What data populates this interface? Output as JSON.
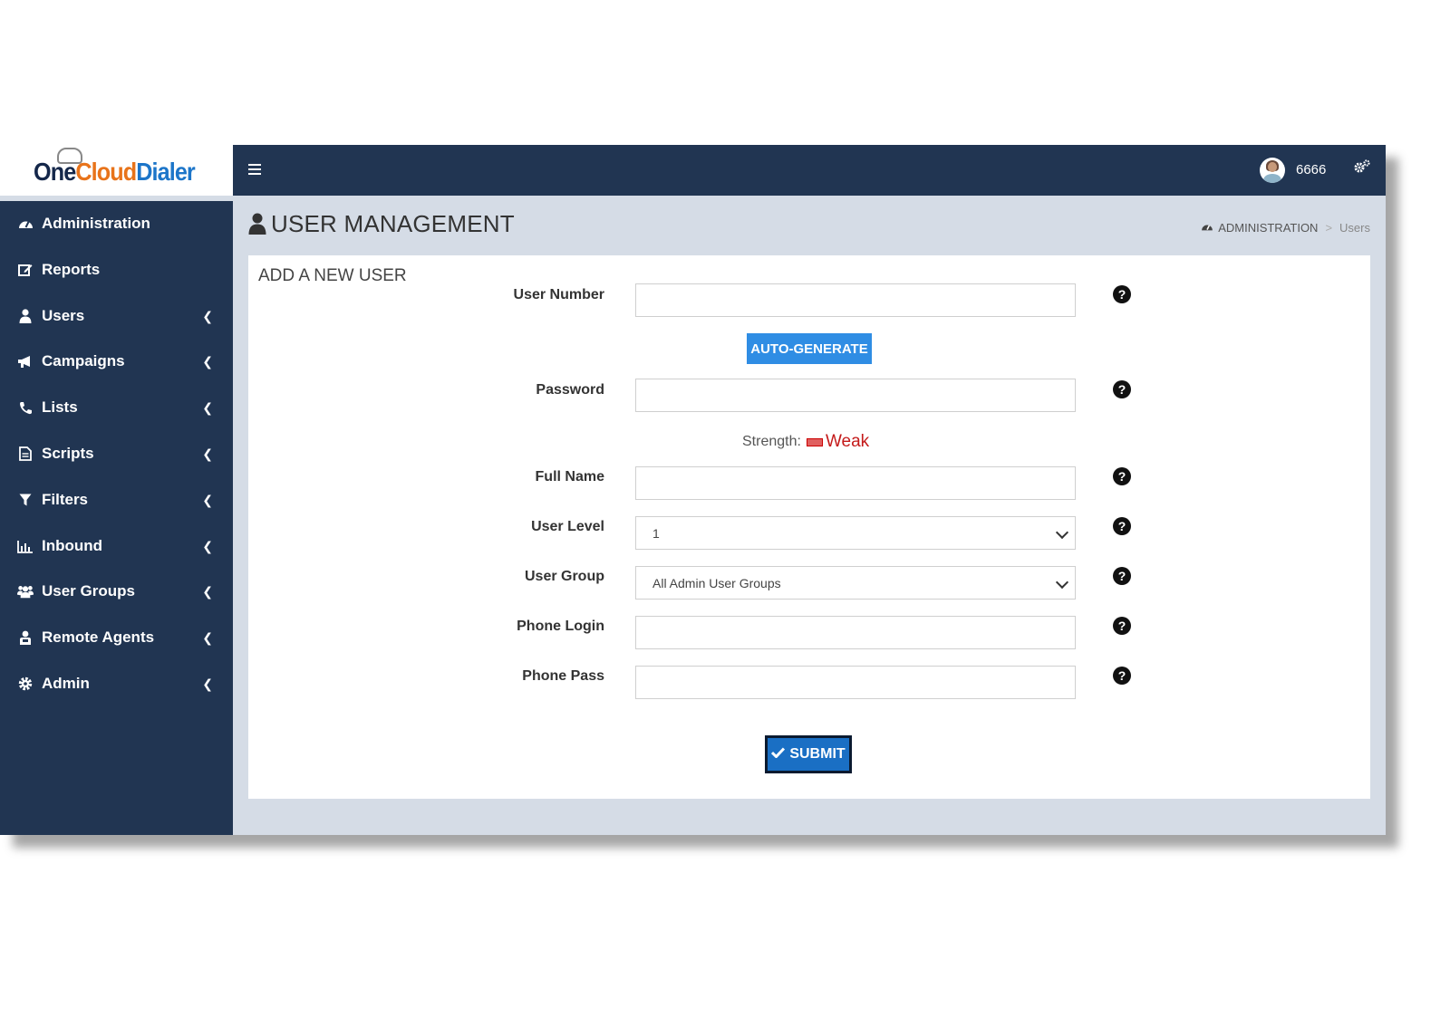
{
  "logo": {
    "part1": "One",
    "part2": "Cloud",
    "part3": "Dialer"
  },
  "topbar": {
    "username": "6666"
  },
  "sidebar": {
    "items": [
      {
        "label": "Administration",
        "icon": "dashboard-icon",
        "has_chevron": false
      },
      {
        "label": "Reports",
        "icon": "edit-icon",
        "has_chevron": false
      },
      {
        "label": "Users",
        "icon": "user-icon",
        "has_chevron": true
      },
      {
        "label": "Campaigns",
        "icon": "bullhorn-icon",
        "has_chevron": true
      },
      {
        "label": "Lists",
        "icon": "phone-icon",
        "has_chevron": true
      },
      {
        "label": "Scripts",
        "icon": "file-icon",
        "has_chevron": true
      },
      {
        "label": "Filters",
        "icon": "filter-icon",
        "has_chevron": true
      },
      {
        "label": "Inbound",
        "icon": "bar-chart-icon",
        "has_chevron": true
      },
      {
        "label": "User Groups",
        "icon": "users-icon",
        "has_chevron": true
      },
      {
        "label": "Remote Agents",
        "icon": "agent-icon",
        "has_chevron": true
      },
      {
        "label": "Admin",
        "icon": "gear-icon",
        "has_chevron": true
      }
    ]
  },
  "header": {
    "title": "USER MANAGEMENT",
    "breadcrumb": {
      "root": "ADMINISTRATION",
      "current": "Users"
    }
  },
  "form": {
    "title": "ADD A NEW USER",
    "user_number_label": "User Number",
    "user_number_value": "",
    "autogen_label": "AUTO-GENERATE",
    "password_label": "Password",
    "password_value": "",
    "strength_label": "Strength:",
    "strength_value": "Weak",
    "full_name_label": "Full Name",
    "full_name_value": "",
    "user_level_label": "User Level",
    "user_level_value": "1",
    "user_group_label": "User Group",
    "user_group_value": "All Admin User Groups",
    "phone_login_label": "Phone Login",
    "phone_login_value": "",
    "phone_pass_label": "Phone Pass",
    "phone_pass_value": "",
    "help_glyph": "?",
    "submit_label": "SUBMIT"
  },
  "colors": {
    "sidebar": "#213552",
    "content_bg": "#d5dce6",
    "accent": "#2f8de4",
    "weak": "#c41a1a"
  }
}
